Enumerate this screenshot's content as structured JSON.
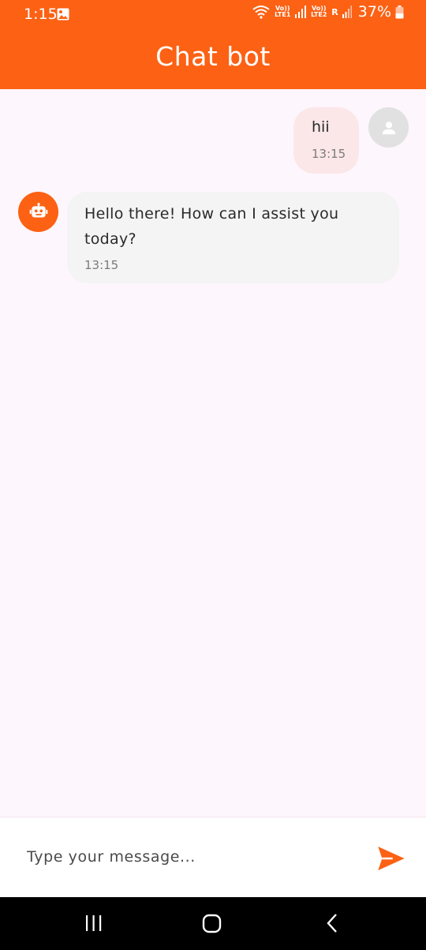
{
  "status_bar": {
    "time": "1:15",
    "sim1_label": "Vo)) LTE1",
    "sim2_label": "Vo)) LTE2",
    "roaming": "R",
    "battery": "37%"
  },
  "app_bar": {
    "title": "Chat bot"
  },
  "messages": [
    {
      "sender": "user",
      "text": "hii",
      "time": "13:15"
    },
    {
      "sender": "bot",
      "text": "Hello there! How can I assist you today?",
      "time": "13:15"
    }
  ],
  "composer": {
    "placeholder": "Type your message...",
    "value": ""
  },
  "colors": {
    "accent": "#fc6114",
    "background": "#fdf6fc",
    "user_bubble": "#fce7e8",
    "bot_bubble": "#f4f4f4"
  },
  "icons": {
    "user_avatar": "person-icon",
    "bot_avatar": "robot-icon",
    "send": "send-icon",
    "nav": [
      "recents-icon",
      "home-icon",
      "back-icon"
    ]
  }
}
